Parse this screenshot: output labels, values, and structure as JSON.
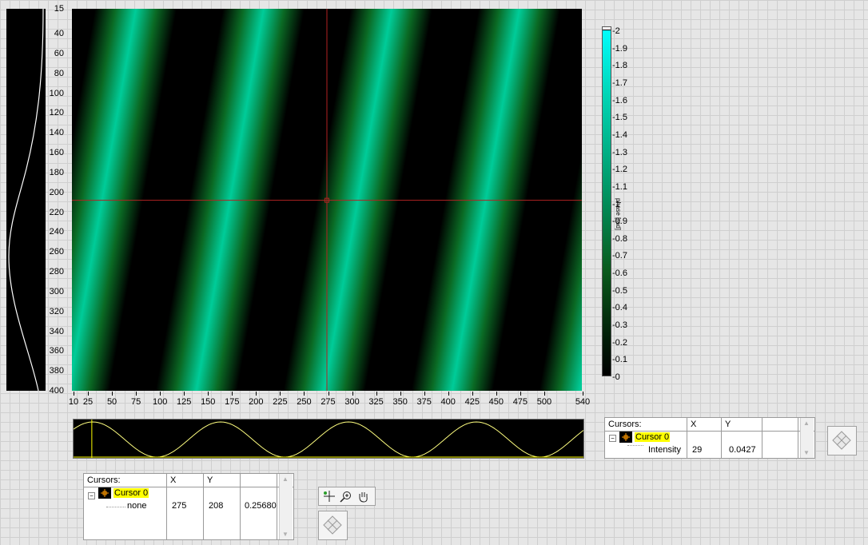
{
  "main_plot": {
    "y_ticks": [
      "15",
      "40",
      "60",
      "80",
      "100",
      "120",
      "140",
      "160",
      "180",
      "200",
      "220",
      "240",
      "260",
      "280",
      "300",
      "320",
      "340",
      "360",
      "380",
      "400"
    ],
    "x_ticks": [
      "10",
      "25",
      "50",
      "75",
      "100",
      "125",
      "150",
      "175",
      "200",
      "225",
      "250",
      "275",
      "300",
      "325",
      "350",
      "375",
      "400",
      "425",
      "450",
      "475",
      "500",
      "540"
    ],
    "cursor": {
      "x": 275,
      "y": 208
    },
    "colors": {
      "dark": "#000000",
      "mid": "#0a5a1c",
      "bright": "#00cc99",
      "cursor_line": "#b22222"
    }
  },
  "colorbar": {
    "ticks": [
      "2",
      "1.9",
      "1.8",
      "1.7",
      "1.6",
      "1.5",
      "1.4",
      "1.3",
      "1.2",
      "1.1",
      "1",
      "0.9",
      "0.8",
      "0.7",
      "0.6",
      "0.5",
      "0.4",
      "0.3",
      "0.2",
      "0.1",
      "0"
    ],
    "label": "phase [rad]",
    "colors": {
      "top": "#00ffff",
      "mid": "#008a5a",
      "bottom": "#000000"
    }
  },
  "cursor_table_bottom": {
    "headers": {
      "name": "Cursors:",
      "x": "X",
      "y": "Y"
    },
    "row": {
      "name": "Cursor 0",
      "x": "275",
      "y": "208",
      "value": "0.25680"
    },
    "sub_label": "none"
  },
  "cursor_table_right": {
    "headers": {
      "name": "Cursors:",
      "x": "X",
      "y": "Y"
    },
    "row": {
      "name": "Cursor 0"
    },
    "sub": {
      "label": "Intensity",
      "x": "29",
      "y": "0.0427"
    }
  },
  "toolbar": {
    "icons": [
      "cursor-move-icon",
      "zoom-icon",
      "pan-hand-icon"
    ]
  },
  "line_profile": {
    "color": "#ffff80",
    "cursor_x": 29
  }
}
